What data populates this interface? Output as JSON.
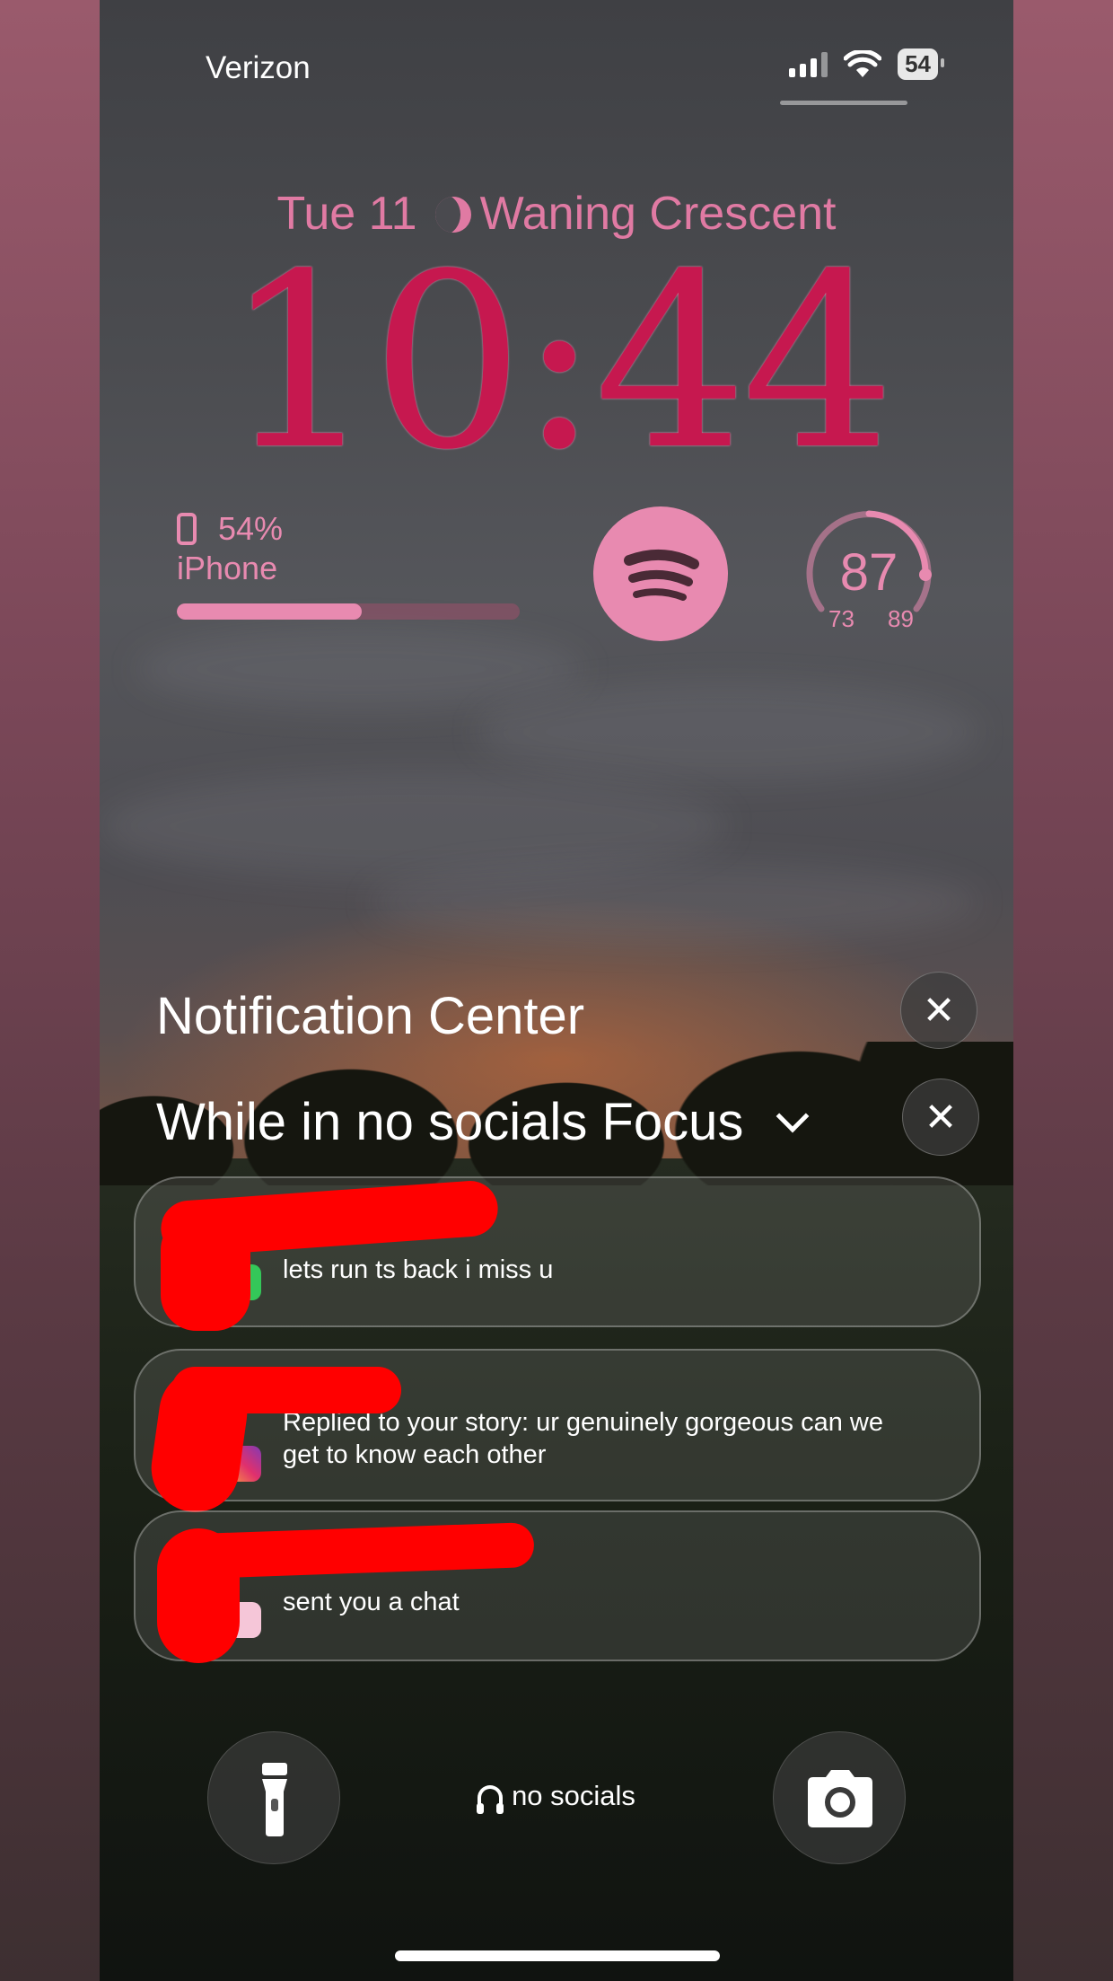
{
  "status_bar": {
    "carrier": "Verizon",
    "battery": "54"
  },
  "lock_screen": {
    "date": "Tue 11",
    "moon_phase": "Waning Crescent",
    "time": "10:44",
    "battery_widget": {
      "percent_text": "54%",
      "device": "iPhone",
      "level": 0.54
    },
    "spotify_widget": {
      "icon": "spotify-icon"
    },
    "weather_widget": {
      "current": "87",
      "low": "73",
      "high": "89"
    }
  },
  "notification_center": {
    "title": "Notification Center",
    "focus_heading": "While in no socials Focus",
    "notifications": [
      {
        "app_icon": "messages-icon",
        "message": "lets run ts back i miss u"
      },
      {
        "app_icon": "instagram-icon",
        "message": "Replied to your story: ur genuinely gorgeous can we get to know each other"
      },
      {
        "app_icon": "snapchat-icon",
        "message": "sent you a chat"
      }
    ]
  },
  "bottom_bar": {
    "left_button": "flashlight-icon",
    "focus_label": "no socials",
    "right_button": "camera-icon"
  },
  "colors": {
    "accent_pink": "#e88ab0",
    "clock_red": "#c6184f",
    "redaction": "#ff0000"
  }
}
